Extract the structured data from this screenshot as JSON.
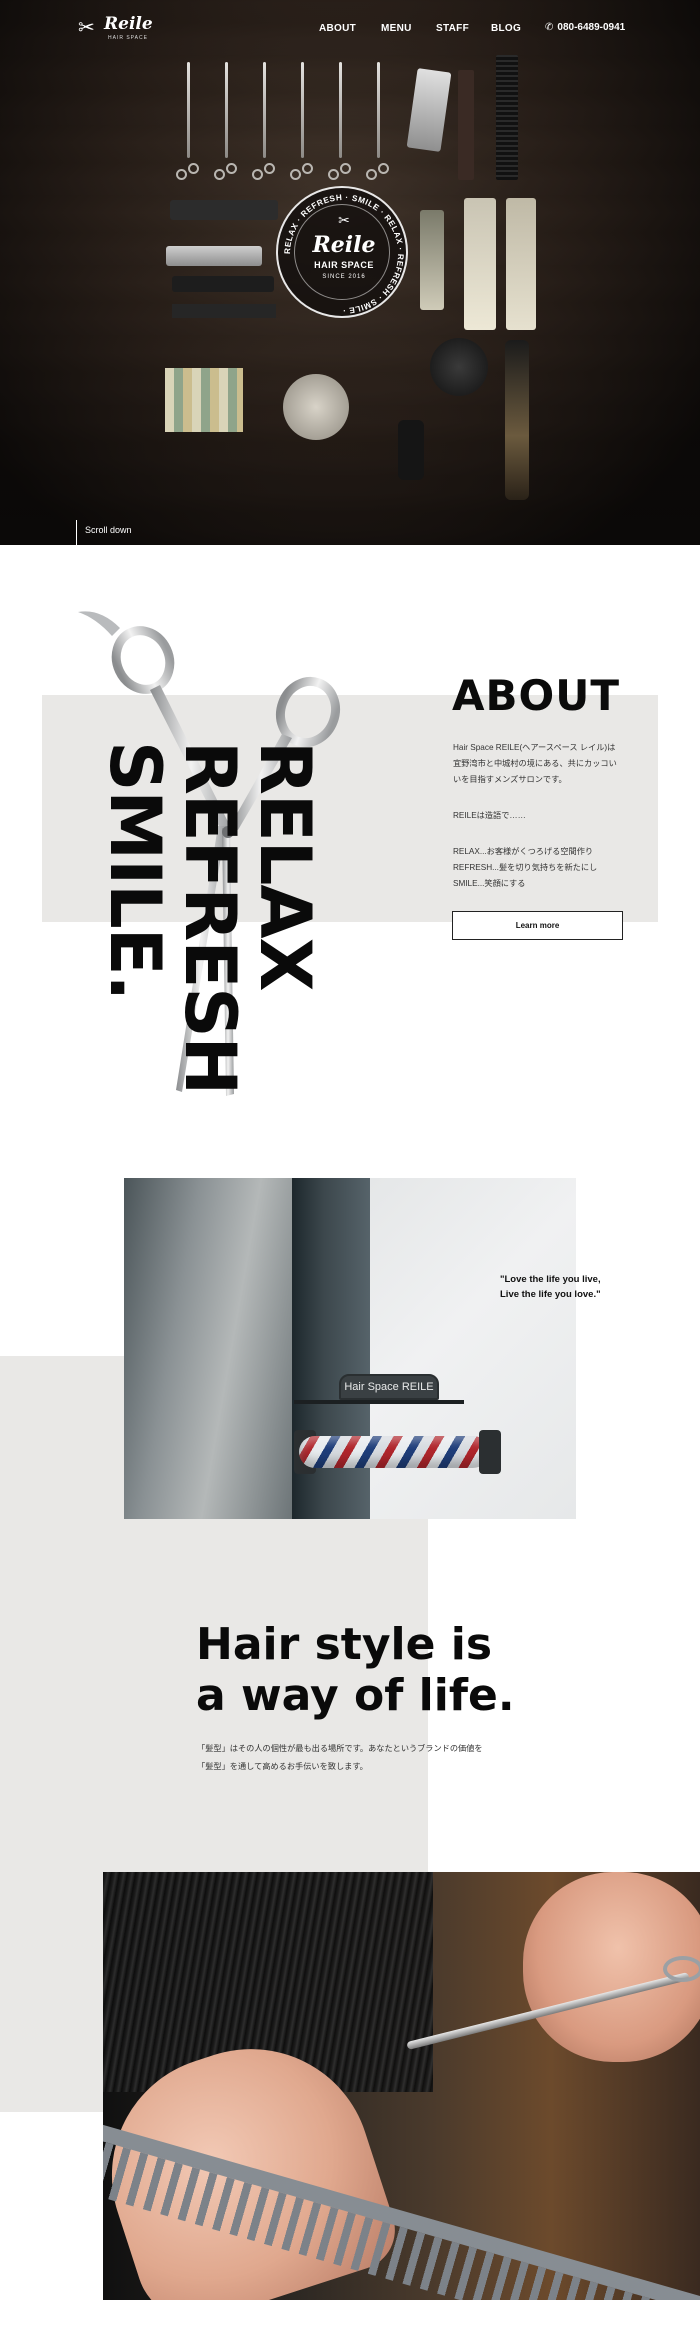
{
  "header": {
    "logo_text": "Reile",
    "logo_sub": "HAIR SPACE",
    "nav": [
      "ABOUT",
      "MENU",
      "STAFF",
      "BLOG"
    ],
    "phone": "080-6489-0941"
  },
  "hero": {
    "emblem_title": "Reile",
    "emblem_sub": "HAIR SPACE",
    "emblem_since": "SINCE 2016",
    "emblem_ring": "RELAX · REFRESH · SMILE · RELAX · REFRESH · SMILE ·",
    "scroll_label": "Scroll down"
  },
  "about": {
    "title": "ABOUT",
    "vertical_words": [
      "RELAX",
      "REFRESH",
      "SMILE."
    ],
    "paragraphs": [
      "Hair Space REILE(ヘアースペース レイル)は",
      "宜野湾市と中城村の境にある、共にカッコい",
      "いを目指すメンズサロンです。",
      "",
      "REILEは造語で……",
      "",
      "RELAX...お客様がくつろげる空間作り",
      "REFRESH...髪を切り気持ちを新たにし",
      "SMILE...笑顔にする"
    ],
    "button_label": "Learn more"
  },
  "sign_section": {
    "sign_text": "Hair Space REILE",
    "quote_line1": "\"Love the life you live,",
    "quote_line2": "Live the life you love.\""
  },
  "life": {
    "title_line1": "Hair style is",
    "title_line2": "a way of life.",
    "body_line1": "「髪型」はその人の個性が最も出る場所です。あなたというブランドの価値を",
    "body_line2": "「髪型」を通して高めるお手伝いを致します。"
  },
  "icons": {
    "logo": "scissors-icon",
    "phone": "phone-icon"
  },
  "colors": {
    "panel_gray": "#e9e8e6",
    "text_black": "#0a0a0a"
  }
}
